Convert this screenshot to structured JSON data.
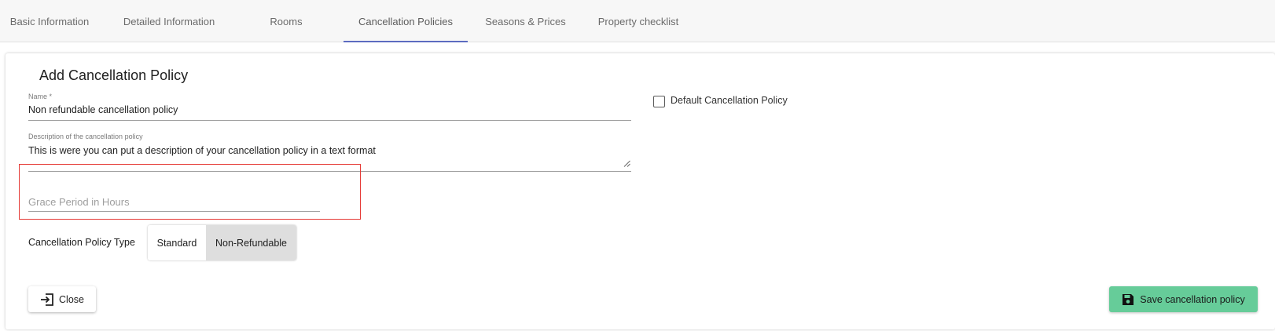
{
  "tabs": [
    {
      "label": "Basic Information",
      "active": false
    },
    {
      "label": "Detailed Information",
      "active": false
    },
    {
      "label": "Rooms",
      "active": false
    },
    {
      "label": "Cancellation Policies",
      "active": true
    },
    {
      "label": "Seasons & Prices",
      "active": false
    },
    {
      "label": "Property checklist",
      "active": false
    }
  ],
  "form": {
    "title": "Add Cancellation Policy",
    "name_label": "Name *",
    "name_value": "Non refundable cancellation policy",
    "default_label": "Default Cancellation Policy",
    "default_checked": false,
    "description_label": "Description of the cancellation policy",
    "description_value": "This is were you can put a description of your cancellation policy in a text format",
    "grace_placeholder": "Grace Period in Hours",
    "type_label": "Cancellation Policy Type",
    "type_options": [
      "Standard",
      "Non-Refundable"
    ],
    "type_selected": "Non-Refundable"
  },
  "actions": {
    "close_label": "Close",
    "close_icon": "exit-arrow-icon",
    "save_label": "Save cancellation policy",
    "save_icon": "floppy-disk-icon"
  },
  "colors": {
    "accent_tab": "#5c6bc0",
    "save_button": "#66cc99",
    "highlight": "#e53935",
    "selected_toggle": "#dedede"
  }
}
